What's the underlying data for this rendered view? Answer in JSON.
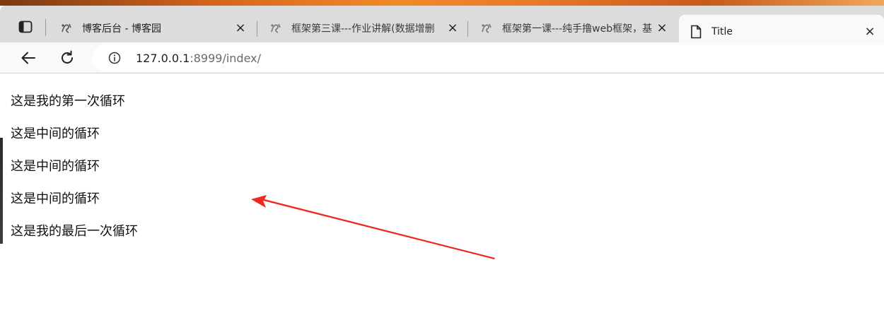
{
  "browser": {
    "tabs": [
      {
        "title": "博客后台 - 博客园",
        "favicon": "cnblogs-icon",
        "active": false
      },
      {
        "title": "框架第三课---作业讲解(数据增删",
        "favicon": "cnblogs-icon",
        "active": false
      },
      {
        "title": "框架第一课---纯手撸web框架，基",
        "favicon": "cnblogs-icon",
        "active": false
      },
      {
        "title": "Title",
        "favicon": "page-icon",
        "active": true
      }
    ],
    "close_glyph": "×",
    "address_bar": {
      "host": "127.0.0.1",
      "rest": ":8999/index/"
    }
  },
  "page": {
    "lines": [
      "这是我的第一次循环",
      "这是中间的循环",
      "这是中间的循环",
      "这是中间的循环",
      "这是我的最后一次循环"
    ]
  },
  "annotation": {
    "arrow_color": "#f0281e"
  }
}
